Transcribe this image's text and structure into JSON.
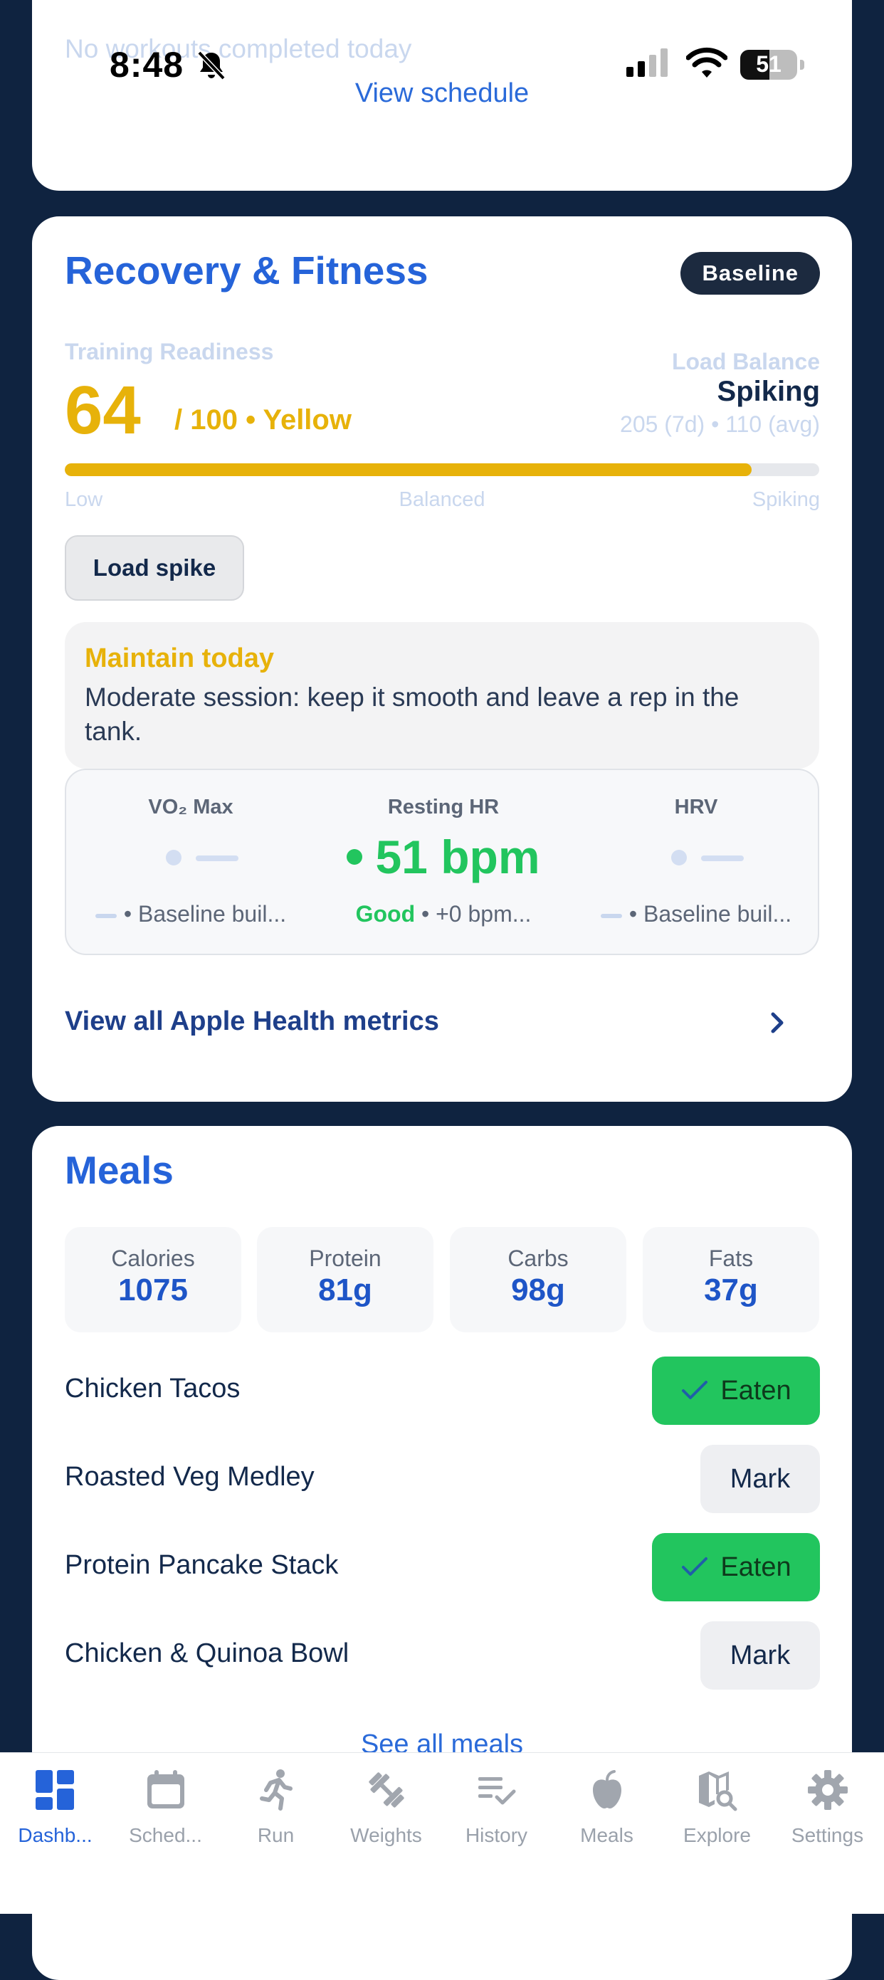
{
  "status_bar": {
    "time": "8:48",
    "battery": "51"
  },
  "top_card": {
    "empty_text": "No workouts completed today",
    "link": "View schedule"
  },
  "recovery": {
    "title": "Recovery & Fitness",
    "badge": "Baseline",
    "readiness_label": "Training Readiness",
    "readiness_score": "64",
    "readiness_suffix": "/ 100 • Yellow",
    "load_balance_label": "Load Balance",
    "load_balance_value": "Spiking",
    "load_balance_sub": "205 (7d) • 110 (avg)",
    "bar_fill_fraction": 0.91,
    "bar_labels": {
      "low": "Low",
      "mid": "Balanced",
      "high": "Spiking"
    },
    "chip": "Load spike",
    "advice_title": "Maintain today",
    "advice_body": "Moderate session: keep it smooth and leave a rep in the tank.",
    "metrics": [
      {
        "title": "VO₂ Max",
        "foot": "• Baseline buil..."
      },
      {
        "title": "Resting HR",
        "value": "51 bpm",
        "status": "Good",
        "foot": "• +0 bpm..."
      },
      {
        "title": "HRV",
        "foot": "• Baseline buil..."
      }
    ],
    "view_all": "View all Apple Health metrics"
  },
  "meals": {
    "title": "Meals",
    "macros": [
      {
        "label": "Calories",
        "value": "1075"
      },
      {
        "label": "Protein",
        "value": "81g"
      },
      {
        "label": "Carbs",
        "value": "98g"
      },
      {
        "label": "Fats",
        "value": "37g"
      }
    ],
    "items": [
      {
        "name": "Chicken Tacos",
        "action": "Eaten"
      },
      {
        "name": "Roasted Veg Medley",
        "action": "Mark"
      },
      {
        "name": "Protein Pancake Stack",
        "action": "Eaten"
      },
      {
        "name": "Chicken & Quinoa Bowl",
        "action": "Mark"
      }
    ],
    "see_all": "See all meals"
  },
  "tabs": [
    {
      "label": "Dashb...",
      "icon": "dashboard-grid-icon"
    },
    {
      "label": "Sched...",
      "icon": "calendar-icon"
    },
    {
      "label": "Run",
      "icon": "runner-icon"
    },
    {
      "label": "Weights",
      "icon": "dumbbell-icon"
    },
    {
      "label": "History",
      "icon": "checklist-icon"
    },
    {
      "label": "Meals",
      "icon": "apple-icon"
    },
    {
      "label": "Explore",
      "icon": "map-search-icon"
    },
    {
      "label": "Settings",
      "icon": "gear-icon"
    }
  ],
  "colors": {
    "background": "#0f2340",
    "accent_blue": "#2563d9",
    "readiness_yellow": "#e7b20a",
    "good_green": "#22c55e"
  }
}
